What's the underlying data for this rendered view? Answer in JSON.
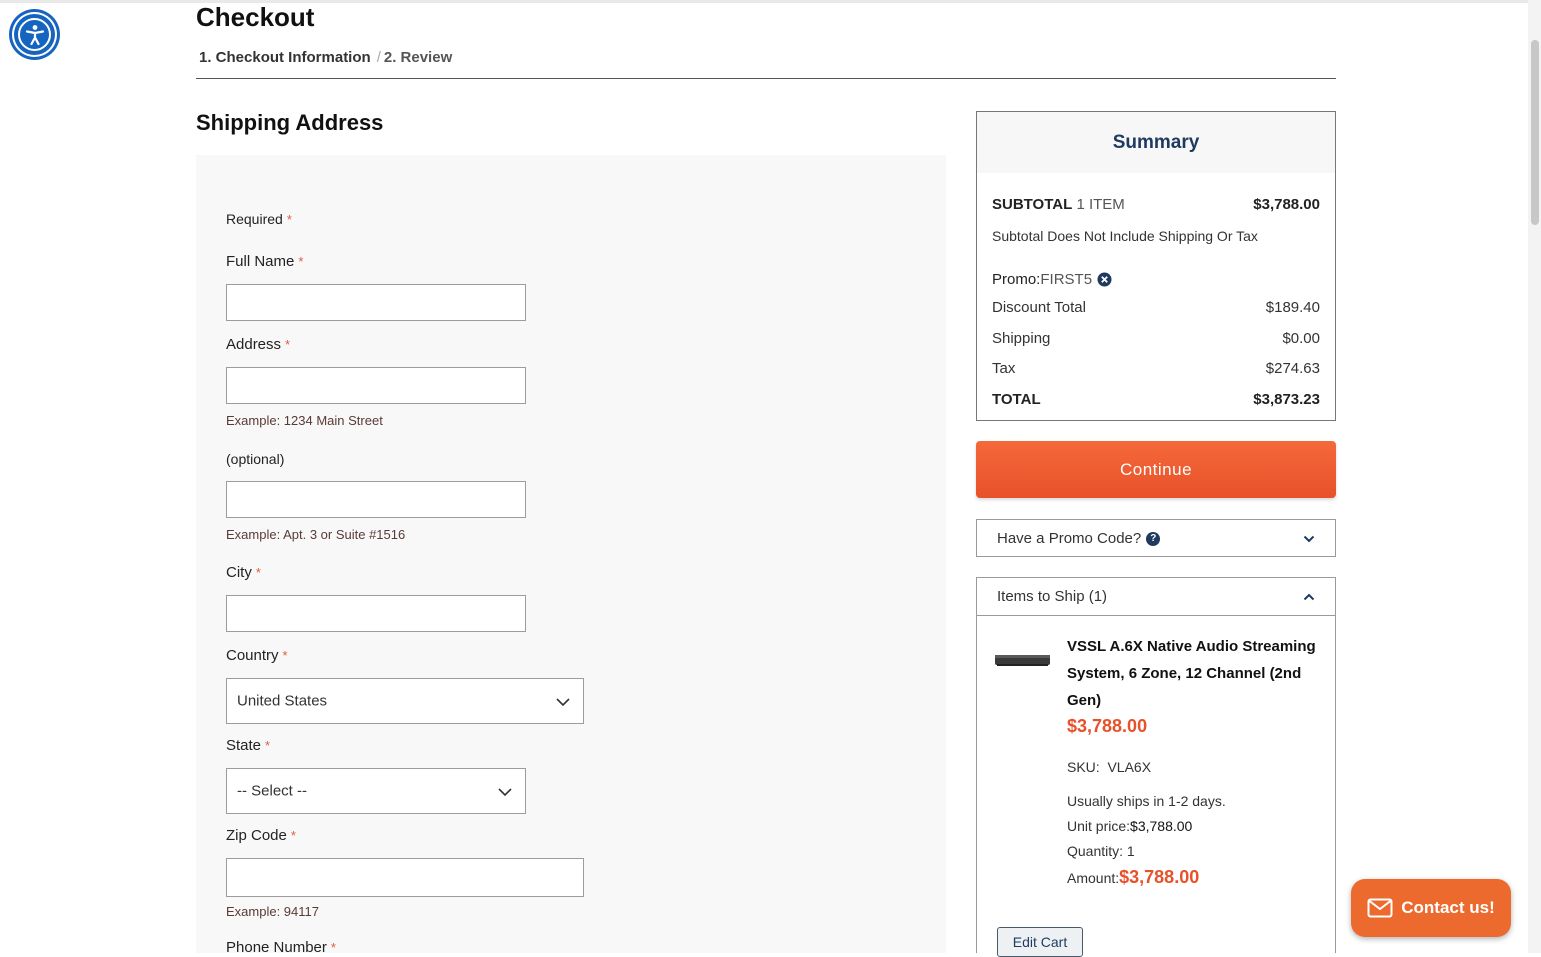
{
  "page": {
    "title": "Checkout",
    "steps": [
      "1. Checkout Information",
      "2. Review"
    ],
    "step_separator": "/"
  },
  "shipping": {
    "title": "Shipping Address",
    "required_label": "Required",
    "required_marker": "*",
    "full_name_label": "Full Name",
    "address_label": "Address",
    "address_hint": "Example: 1234 Main Street",
    "optional_label": "(optional)",
    "address2_hint": "Example: Apt. 3 or Suite #1516",
    "city_label": "City",
    "country_label": "Country",
    "country_value": "United States",
    "state_label": "State",
    "state_value": "-- Select --",
    "zip_label": "Zip Code",
    "zip_hint": "Example: 94117",
    "phone_label": "Phone Number"
  },
  "summary": {
    "title": "Summary",
    "subtotal_label": "SUBTOTAL",
    "subtotal_items": "1 ITEM",
    "subtotal_value": "$3,788.00",
    "subtotal_note": "Subtotal Does Not Include Shipping Or Tax",
    "promo_label": "Promo:",
    "promo_code": "FIRST5",
    "discount_label": "Discount Total",
    "discount_value": "$189.40",
    "shipping_label": "Shipping",
    "shipping_value": "$0.00",
    "tax_label": "Tax",
    "tax_value": "$274.63",
    "total_label": "TOTAL",
    "total_value": "$3,873.23"
  },
  "continue_label": "Continue",
  "promo_panel": {
    "label": "Have a Promo Code?"
  },
  "items": {
    "header": "Items to Ship (1)",
    "product": {
      "name": "VSSL A.6X Native Audio Streaming System, 6 Zone, 12 Channel (2nd Gen)",
      "price": "$3,788.00",
      "sku_label": "SKU:",
      "sku": "VLA6X",
      "ships": "Usually ships in 1-2 days.",
      "unit_price_label": "Unit price:",
      "unit_price": "$3,788.00",
      "quantity_label": "Quantity:",
      "quantity": "1",
      "amount_label": "Amount:",
      "amount": "$3,788.00"
    },
    "edit_cart_label": "Edit Cart"
  },
  "contact_label": "Contact us!",
  "colors": {
    "accent": "#e8512a",
    "navy": "#1e3a5f",
    "a11y_blue": "#1565c0"
  }
}
